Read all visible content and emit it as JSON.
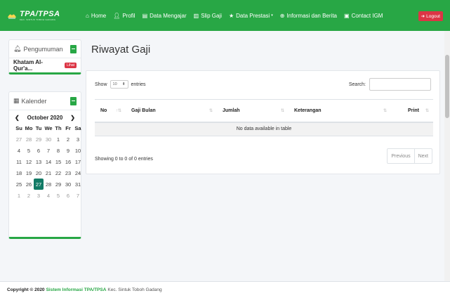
{
  "navbar": {
    "brand_title": "TPA/TPSA",
    "brand_sub": "KEC. SINTUK TOBOH GADANG",
    "items": [
      {
        "label": "Home",
        "icon": "home-icon"
      },
      {
        "label": "Profil",
        "icon": "user-icon"
      },
      {
        "label": "Data Mengajar",
        "icon": "book-icon"
      },
      {
        "label": "Slip Gaji",
        "icon": "money-icon"
      },
      {
        "label": "Data Prestasi",
        "icon": "star-icon"
      },
      {
        "label": "Informasi dan Berita",
        "icon": "globe-icon"
      },
      {
        "label": "Contact IGM",
        "icon": "contact-icon"
      }
    ],
    "logout": "Logout"
  },
  "announce": {
    "title": "Pengumuman",
    "item": "Khatam Al-Qur'a...",
    "badge": "Lihat"
  },
  "calendar": {
    "title": "Kalender",
    "month": "October 2020",
    "prev": "❮",
    "next": "❯",
    "dows": [
      "Su",
      "Mo",
      "Tu",
      "We",
      "Th",
      "Fr",
      "Sa"
    ],
    "days": [
      {
        "d": "27",
        "m": true
      },
      {
        "d": "28",
        "m": true
      },
      {
        "d": "29",
        "m": true
      },
      {
        "d": "30",
        "m": true
      },
      {
        "d": "1"
      },
      {
        "d": "2"
      },
      {
        "d": "3"
      },
      {
        "d": "4"
      },
      {
        "d": "5"
      },
      {
        "d": "6"
      },
      {
        "d": "7"
      },
      {
        "d": "8"
      },
      {
        "d": "9"
      },
      {
        "d": "10"
      },
      {
        "d": "11"
      },
      {
        "d": "12"
      },
      {
        "d": "13"
      },
      {
        "d": "14"
      },
      {
        "d": "15"
      },
      {
        "d": "16"
      },
      {
        "d": "17"
      },
      {
        "d": "18"
      },
      {
        "d": "19"
      },
      {
        "d": "20"
      },
      {
        "d": "21"
      },
      {
        "d": "22"
      },
      {
        "d": "23"
      },
      {
        "d": "24"
      },
      {
        "d": "25"
      },
      {
        "d": "26"
      },
      {
        "d": "27",
        "t": true
      },
      {
        "d": "28"
      },
      {
        "d": "29"
      },
      {
        "d": "30"
      },
      {
        "d": "31"
      },
      {
        "d": "1",
        "m": true
      },
      {
        "d": "2",
        "m": true
      },
      {
        "d": "3",
        "m": true
      },
      {
        "d": "4",
        "m": true
      },
      {
        "d": "5",
        "m": true
      },
      {
        "d": "6",
        "m": true
      },
      {
        "d": "7",
        "m": true
      }
    ]
  },
  "main": {
    "title": "Riwayat Gaji",
    "show": "Show",
    "entries_value": "10",
    "entries": "entries",
    "search": "Search:",
    "columns": [
      "No",
      "Gaji Bulan",
      "Jumlah",
      "Keterangan",
      "Print"
    ],
    "empty": "No data available in table",
    "info": "Showing 0 to 0 of 0 entries",
    "prev": "Previous",
    "next": "Next"
  },
  "footer": {
    "copyright": "Copyright © 2020",
    "system": "Sistem Informasi TPA/TPSA",
    "rest": "Kec. Sintuk Toboh Gadang"
  },
  "colors": {
    "primary": "#28a745",
    "danger": "#dc3545",
    "today": "#117a65"
  }
}
